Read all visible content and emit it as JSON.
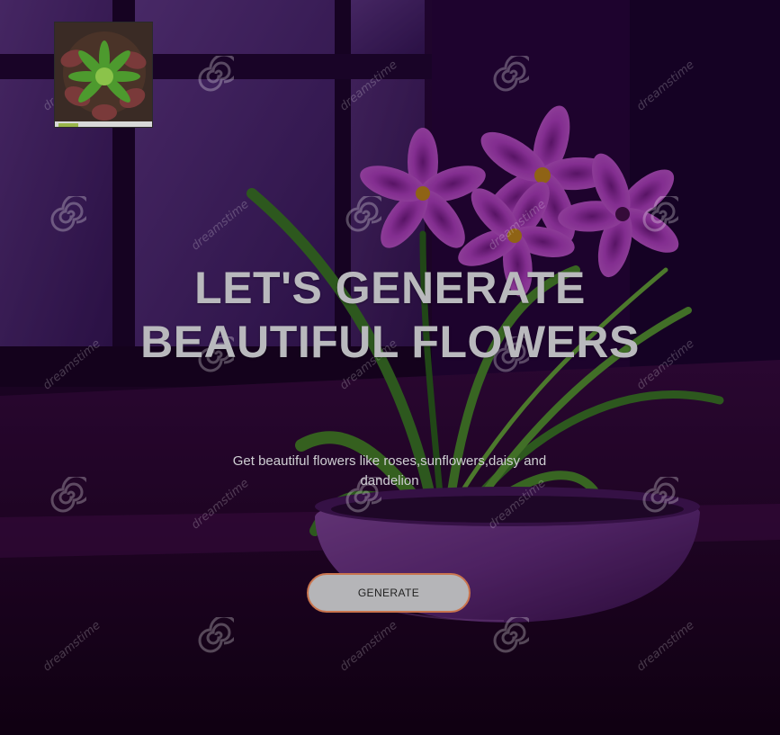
{
  "hero": {
    "headline": "LET'S GENERATE BEAUTIFUL FLOWERS",
    "subtitle": "Get beautiful flowers like roses,sunflowers,daisy and dandelion"
  },
  "cta": {
    "label": "GENERATE"
  },
  "watermark": {
    "text": "dreamstime",
    "icon": "spiral-icon"
  },
  "logo": {
    "icon": "flower-logo-icon"
  },
  "colors": {
    "background": "#3a0a4a",
    "headline": "#b9b9bd",
    "button_fill": "#b5b5b8",
    "button_border": "#c9744e",
    "petal": "#b640c8"
  }
}
